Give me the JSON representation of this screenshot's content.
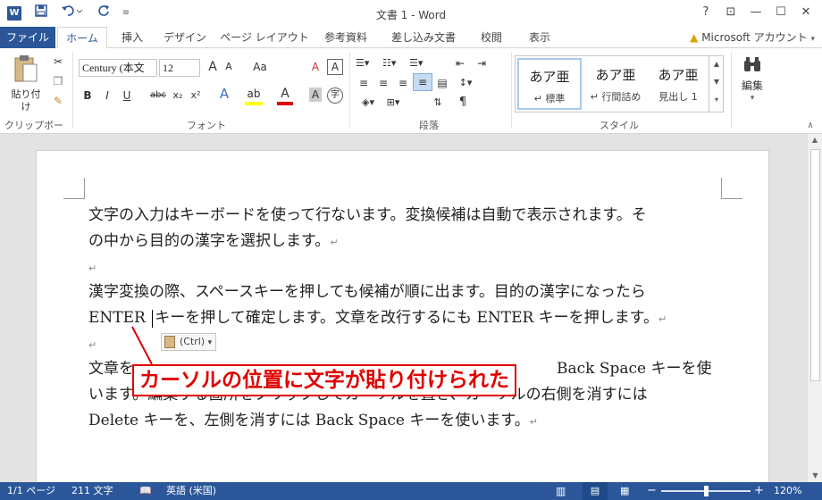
{
  "app": {
    "title": "文書 1 - Word",
    "logo_letter": "W",
    "help": "?",
    "window_controls": {
      "ribbon_display": "⊡",
      "minimize": "—",
      "maximize": "☐",
      "close": "✕"
    }
  },
  "qat": {
    "save_icon": "save-icon",
    "undo_icon": "undo-icon",
    "redo_icon": "redo-icon",
    "customize": "≡"
  },
  "tabs": {
    "file": "ファイル",
    "home": "ホーム",
    "insert": "挿入",
    "design": "デザイン",
    "layout": "ページ レイアウト",
    "references": "参考資料",
    "mailings": "差し込み文書",
    "review": "校閲",
    "view": "表示",
    "account": "Microsoft アカウント"
  },
  "ribbon": {
    "clipboard": {
      "label": "クリップボード",
      "paste": "貼り付け"
    },
    "font": {
      "label": "フォント",
      "font_name": "Century (本文",
      "font_size": "12",
      "grow": "A",
      "shrink": "A",
      "case": "Aa",
      "clear": "A",
      "bold": "B",
      "italic": "I",
      "underline": "U",
      "strike": "abc",
      "subscript": "x₂",
      "superscript": "x²",
      "effects": "A",
      "highlight": "ab",
      "font_color": "A",
      "char_shade": "A",
      "enclosed": "字"
    },
    "paragraph": {
      "label": "段落"
    },
    "styles": {
      "label": "スタイル",
      "items": [
        {
          "sample": "あア亜",
          "name": "↵ 標準"
        },
        {
          "sample": "あア亜",
          "name": "↵ 行間詰め"
        },
        {
          "sample": "あア亜",
          "name": "見出し 1"
        }
      ]
    },
    "editing": {
      "label": "編集"
    }
  },
  "document": {
    "p1_line1": "文字の入力はキーボードを使って行ないます。変換候補は自動で表示されます。そ",
    "p1_line2": "の中から目的の漢字を選択します。",
    "p3_line1": "漢字変換の際、スペースキーを押しても候補が順に出ます。目的の漢字になったら",
    "p3_line2a": "ENTER",
    "p3_line2b": "キーを押して確定します。文章を改行するにも ENTER キーを押します。",
    "p5_line1a": "文章を",
    "p5_line1b": "Back Space キーを使",
    "p5_line2a": "います。編集する箇所をクリックしてカーソルを置き、カー",
    "p5_line2b": "ソルの右側を消すには",
    "p5_line3": "Delete キーを、左側を消すには Back Space キーを使います。",
    "para_mark": "↵",
    "paste_options": "(Ctrl)",
    "callout": "カーソルの位置に文字が貼り付けられた"
  },
  "status": {
    "page": "1/1 ページ",
    "words": "211 文字",
    "language": "英語 (米国)",
    "zoom": "120%",
    "zoom_minus": "−",
    "zoom_plus": "+"
  },
  "colors": {
    "word_blue": "#2b579a",
    "callout_red": "#e00000"
  }
}
